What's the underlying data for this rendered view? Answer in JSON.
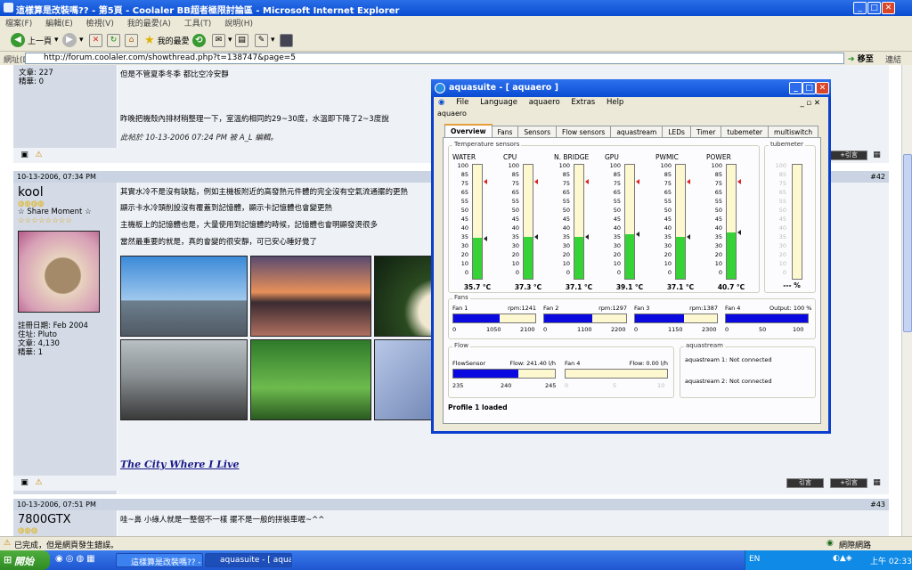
{
  "ie": {
    "title": "這樣算是改裝嗎?? - 第5頁 - Coolaler BB超者極限討論區 - Microsoft Internet Explorer",
    "menu": [
      "檔案(F)",
      "編輯(E)",
      "檢視(V)",
      "我的最愛(A)",
      "工具(T)",
      "說明(H)"
    ],
    "back_label": "上一頁",
    "favorites_label": "我的最愛",
    "address_label": "網址(D)",
    "address_value": "http://forum.coolaler.com/showthread.php?t=138747&page=5",
    "go_label": "移至",
    "links_label": "連結",
    "status_left": "已完成，但是網頁發生錯誤。",
    "status_right": "網際網路"
  },
  "forum": {
    "top_stats": [
      "文章: 227",
      "精華: 0"
    ],
    "post1_lines": [
      "但是不管夏季冬季 都比空冷安靜",
      "昨晚把機殼內排材稍整理一下，室溫約相同的29~30度，水溫即下降了2~3度說"
    ],
    "post1_edit": "此帖於 10-13-2006 07:24 PM 被 A_L 編輯。",
    "post2_date": "10-13-2006, 07:34 PM",
    "post2_num": "#42",
    "user2": {
      "name": "kool",
      "title": "☆ Share Moment ☆",
      "info": [
        "註冊日期: Feb 2004",
        "住址: Pluto",
        "文章: 4,130",
        "精華: 1"
      ]
    },
    "post2_lines": [
      "其實水冷不是沒有缺點，例如主機板附近的高發熱元件體的完全沒有空氣流通擺的更熱",
      "顯示卡水冷頭削設沒有覆蓋到記憶體，顯示卡記憶體也會變更熱",
      "主機板上的記憶體也是，大量使用到記憶體的時候，記憶體也會明顯發燙很多",
      "當然最重要的就是，真的會變的很安靜，可已安心睡好覺了"
    ],
    "signature_link": "The City Where I Live",
    "post3_date": "10-13-2006, 07:51 PM",
    "post3_num": "#43",
    "user3_name": "7800GTX",
    "post3_line": "哇~鼻 小綠人就是一整個不一樣 擺不是一般的拼裝車喔~^^",
    "reply_label": "引言",
    "quote_label": "+引言"
  },
  "aqua": {
    "title": "aquasuite - [ aquaero ]",
    "menu": [
      "File",
      "Language",
      "aquaero",
      "Extras",
      "Help"
    ],
    "sub": "aquaero",
    "tabs": [
      "Overview",
      "Fans",
      "Sensors",
      "Flow sensors",
      "aquastream",
      "LEDs",
      "Timer",
      "tubemeter",
      "multiswitch"
    ],
    "temp_group": "Temperature sensors",
    "ticks": [
      "100",
      "85",
      "75",
      "65",
      "55",
      "50",
      "45",
      "40",
      "35",
      "30",
      "20",
      "10",
      "0"
    ],
    "sensors": [
      {
        "name": "WATER",
        "value": "35.7 °C",
        "level": 0.357
      },
      {
        "name": "CPU",
        "value": "37.3 °C",
        "level": 0.373
      },
      {
        "name": "N. BRIDGE",
        "value": "37.1 °C",
        "level": 0.371
      },
      {
        "name": "GPU",
        "value": "39.1 °C",
        "level": 0.391
      },
      {
        "name": "PWMIC",
        "value": "37.1 °C",
        "level": 0.371
      },
      {
        "name": "POWER",
        "value": "40.7 °C",
        "level": 0.407
      }
    ],
    "tube_group": "tubemeter",
    "tube_value": "--- %",
    "fans_group": "Fans",
    "fans": [
      {
        "name": "Fan 1",
        "rpm": "rpm:1241",
        "level": 0.56,
        "s0": "0",
        "s1": "1050",
        "s2": "2100"
      },
      {
        "name": "Fan 2",
        "rpm": "rpm:1297",
        "level": 0.59,
        "s0": "0",
        "s1": "1100",
        "s2": "2200"
      },
      {
        "name": "Fan 3",
        "rpm": "rpm:1387",
        "level": 0.6,
        "s0": "0",
        "s1": "1150",
        "s2": "2300"
      },
      {
        "name": "Fan 4",
        "rpm": "Output: 100 %",
        "level": 1.0,
        "s0": "0",
        "s1": "50",
        "s2": "100"
      }
    ],
    "flow_group": "Flow",
    "flow": [
      {
        "name": "FlowSensor",
        "value": "Flow: 241.40 l/h",
        "level": 0.64,
        "s0": "235",
        "s1": "240",
        "s2": "245"
      },
      {
        "name": "Fan 4",
        "value": "Flow: 0.00 l/h",
        "level": 0.0,
        "s0": "0",
        "s1": "5",
        "s2": "10"
      }
    ],
    "aquastream_group": "aquastream",
    "aquastream": [
      {
        "label": "aquastream 1:",
        "value": "Not connected"
      },
      {
        "label": "aquastream 2:",
        "value": "Not connected"
      }
    ],
    "status": "Profile 1 loaded"
  },
  "taskbar": {
    "start": "開始",
    "buttons": [
      "這樣算是改裝嗎?? - ...",
      "aquasuite - [ aquaero ]"
    ],
    "lang": "EN",
    "clock": "上午 02:33"
  }
}
